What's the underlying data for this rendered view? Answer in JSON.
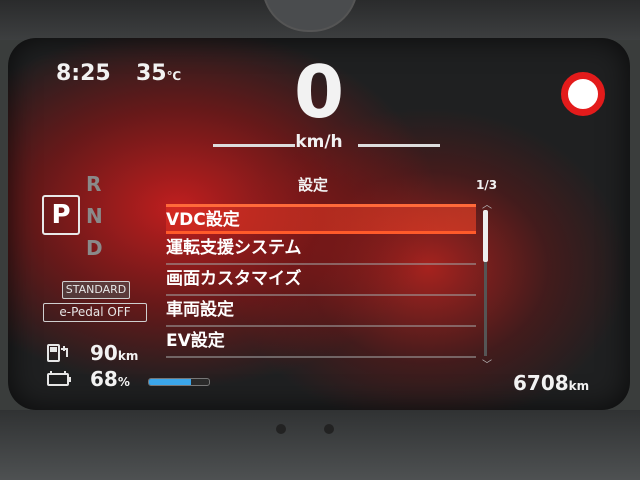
{
  "status": {
    "time": "8:25",
    "temperature": "35",
    "temperature_unit": "℃"
  },
  "speed": {
    "value": "0",
    "unit": "km/h"
  },
  "speed_limit_sign": {
    "text": ""
  },
  "gear": {
    "selected": "P",
    "options": [
      "R",
      "N",
      "D"
    ]
  },
  "drive_mode": {
    "mode": "STANDARD",
    "epedal": "e-Pedal OFF"
  },
  "range": {
    "value": "90",
    "unit": "km"
  },
  "battery": {
    "value": "68",
    "unit": "%",
    "bar_level": 0.7
  },
  "menu": {
    "title": "設定",
    "page_indicator": "1/3",
    "items": [
      {
        "label": "VDC設定",
        "selected": true
      },
      {
        "label": "運転支援システム"
      },
      {
        "label": "画面カスタマイズ"
      },
      {
        "label": "車両設定"
      },
      {
        "label": "EV設定"
      }
    ]
  },
  "odometer": {
    "value": "6708",
    "unit": "km"
  },
  "colors": {
    "accent": "#ff5a2a",
    "battery_bar": "#3ba6ea",
    "sign_ring": "#e31b1b"
  }
}
